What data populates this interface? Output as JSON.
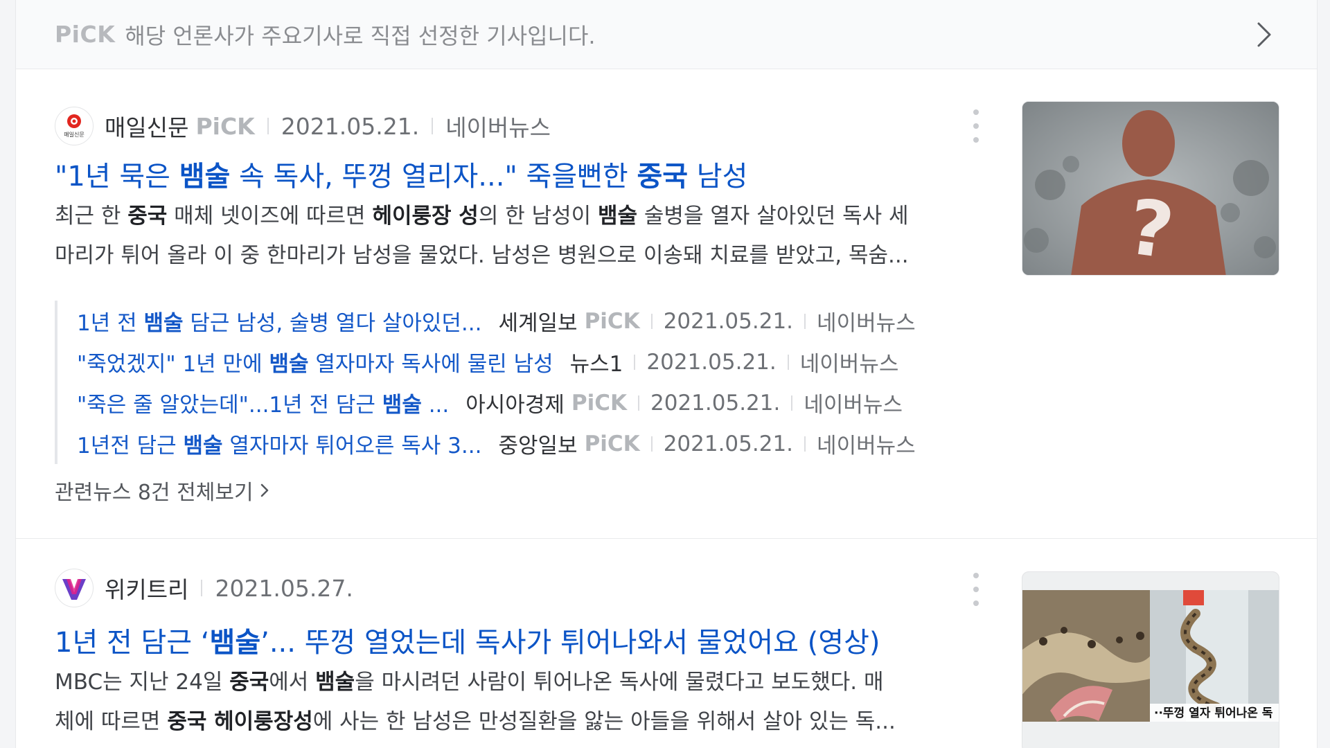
{
  "banner": {
    "pick_mark": "PiCK",
    "text": "해당 언론사가 주요기사로 직접 선정한 기사입니다.",
    "chevron_icon": "chevron-right-icon"
  },
  "articles": [
    {
      "press": "매일신문",
      "press_logo_text": "매일신문",
      "pick": "PiCK",
      "date": "2021.05.21.",
      "naver": "네이버뉴스",
      "title_parts": [
        "\"1년 묵은 ",
        "뱀술",
        " 속 독사, 뚜껑 열리자...\" 죽을뻔한 ",
        "중국",
        " 남성"
      ],
      "desc_line1_parts": [
        "최근 한 ",
        "중국",
        " 매체 넷이즈에 따르면 ",
        "헤이룽장 성",
        "의 한 남성이 ",
        "뱀술",
        " 술병을 열자 살아있던 독사 세"
      ],
      "desc_line2": "마리가 튀어 올라 이 중 한마리가 남성을 물었다. 남성은 병원으로 이송돼 치료를 받았고, 목숨...",
      "thumbnail_question_mark": "?",
      "related": [
        {
          "title_parts": [
            "1년 전 ",
            "뱀술",
            " 담근 남성, 술병 열다 살아있던..."
          ],
          "press": "세계일보",
          "pick": "PiCK",
          "date": "2021.05.21.",
          "naver": "네이버뉴스"
        },
        {
          "title_parts": [
            "\"죽었겠지\" 1년 만에 ",
            "뱀술",
            " 열자마자 독사에 물린 남성"
          ],
          "press": "뉴스1",
          "pick": "",
          "date": "2021.05.21.",
          "naver": "네이버뉴스"
        },
        {
          "title_parts": [
            "\"죽은 줄 알았는데\"...1년 전 담근 ",
            "뱀술",
            " ..."
          ],
          "press": "아시아경제",
          "pick": "PiCK",
          "date": "2021.05.21.",
          "naver": "네이버뉴스"
        },
        {
          "title_parts": [
            "1년전 담근 ",
            "뱀술",
            " 열자마자 튀어오른 독사 3..."
          ],
          "press": "중앙일보",
          "pick": "PiCK",
          "date": "2021.05.21.",
          "naver": "네이버뉴스"
        }
      ],
      "more_news": "관련뉴스 8건 전체보기"
    },
    {
      "press": "위키트리",
      "date": "2021.05.27.",
      "title_parts": [
        "1년 전 담근 ‘",
        "뱀술",
        "’... 뚜껑 열었는데 독사가 튀어나와서 물었어요 (영상)"
      ],
      "desc_line1_parts": [
        "MBC는 지난 24일 ",
        "중국",
        "에서 ",
        "뱀술",
        "을 마시려던 사람이 튀어나온 독사에 물렸다고 보도했다. 매"
      ],
      "desc_line2_parts": [
        "체에 따르면 ",
        "중국 헤이룽장성",
        "에 사는 한 남성은 만성질환을 앓는 아들을 위해서 살아 있는 독..."
      ],
      "thumbnail_caption": "··뚜껑 열자 튀어나온 독"
    }
  ],
  "colors": {
    "link": "#0b54c6",
    "pick_gray": "#b3b6ba",
    "press_red": "#e2261f",
    "wikitree_purple": "#6a3fc7"
  }
}
